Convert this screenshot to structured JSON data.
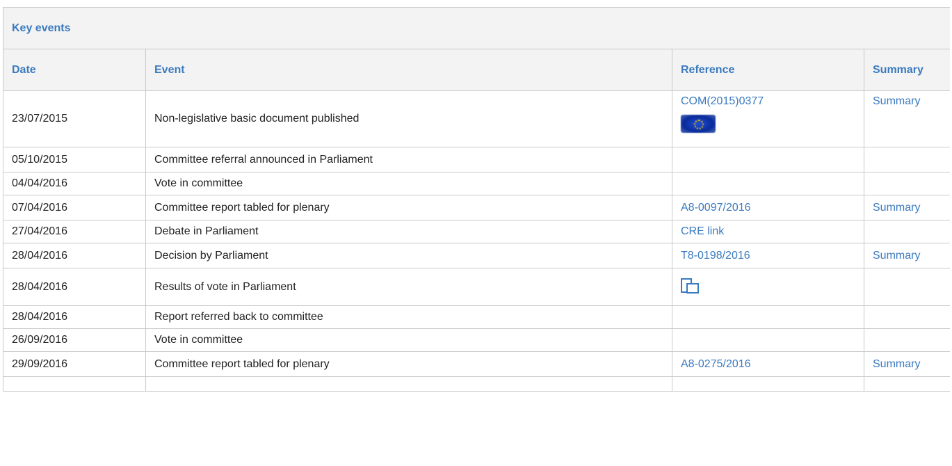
{
  "section_title": "Key events",
  "columns": {
    "date": "Date",
    "event": "Event",
    "reference": "Reference",
    "summary": "Summary"
  },
  "rows": [
    {
      "date": "23/07/2015",
      "event": "Non-legislative basic document published",
      "reference": "COM(2015)0377",
      "reference_icon": "eu-flag-icon",
      "summary": "Summary"
    },
    {
      "date": "05/10/2015",
      "event": "Committee referral announced in Parliament",
      "reference": "",
      "summary": ""
    },
    {
      "date": "04/04/2016",
      "event": "Vote in committee",
      "reference": "",
      "summary": ""
    },
    {
      "date": "07/04/2016",
      "event": "Committee report tabled for plenary",
      "reference": "A8-0097/2016",
      "summary": "Summary"
    },
    {
      "date": "27/04/2016",
      "event": "Debate in Parliament",
      "reference": "CRE link",
      "summary": ""
    },
    {
      "date": "28/04/2016",
      "event": "Decision by Parliament",
      "reference": "T8-0198/2016",
      "summary": "Summary"
    },
    {
      "date": "28/04/2016",
      "event": "Results of vote in Parliament",
      "reference": "",
      "reference_icon": "vote-results-icon",
      "summary": ""
    },
    {
      "date": "28/04/2016",
      "event": "Report referred back to committee",
      "reference": "",
      "summary": ""
    },
    {
      "date": "26/09/2016",
      "event": "Vote in committee",
      "reference": "",
      "summary": ""
    },
    {
      "date": "29/09/2016",
      "event": "Committee report tabled for plenary",
      "reference": "A8-0275/2016",
      "summary": "Summary"
    }
  ],
  "colors": {
    "link": "#3a7abf",
    "header_bg": "#f3f3f3",
    "border": "#c9c9c9"
  }
}
